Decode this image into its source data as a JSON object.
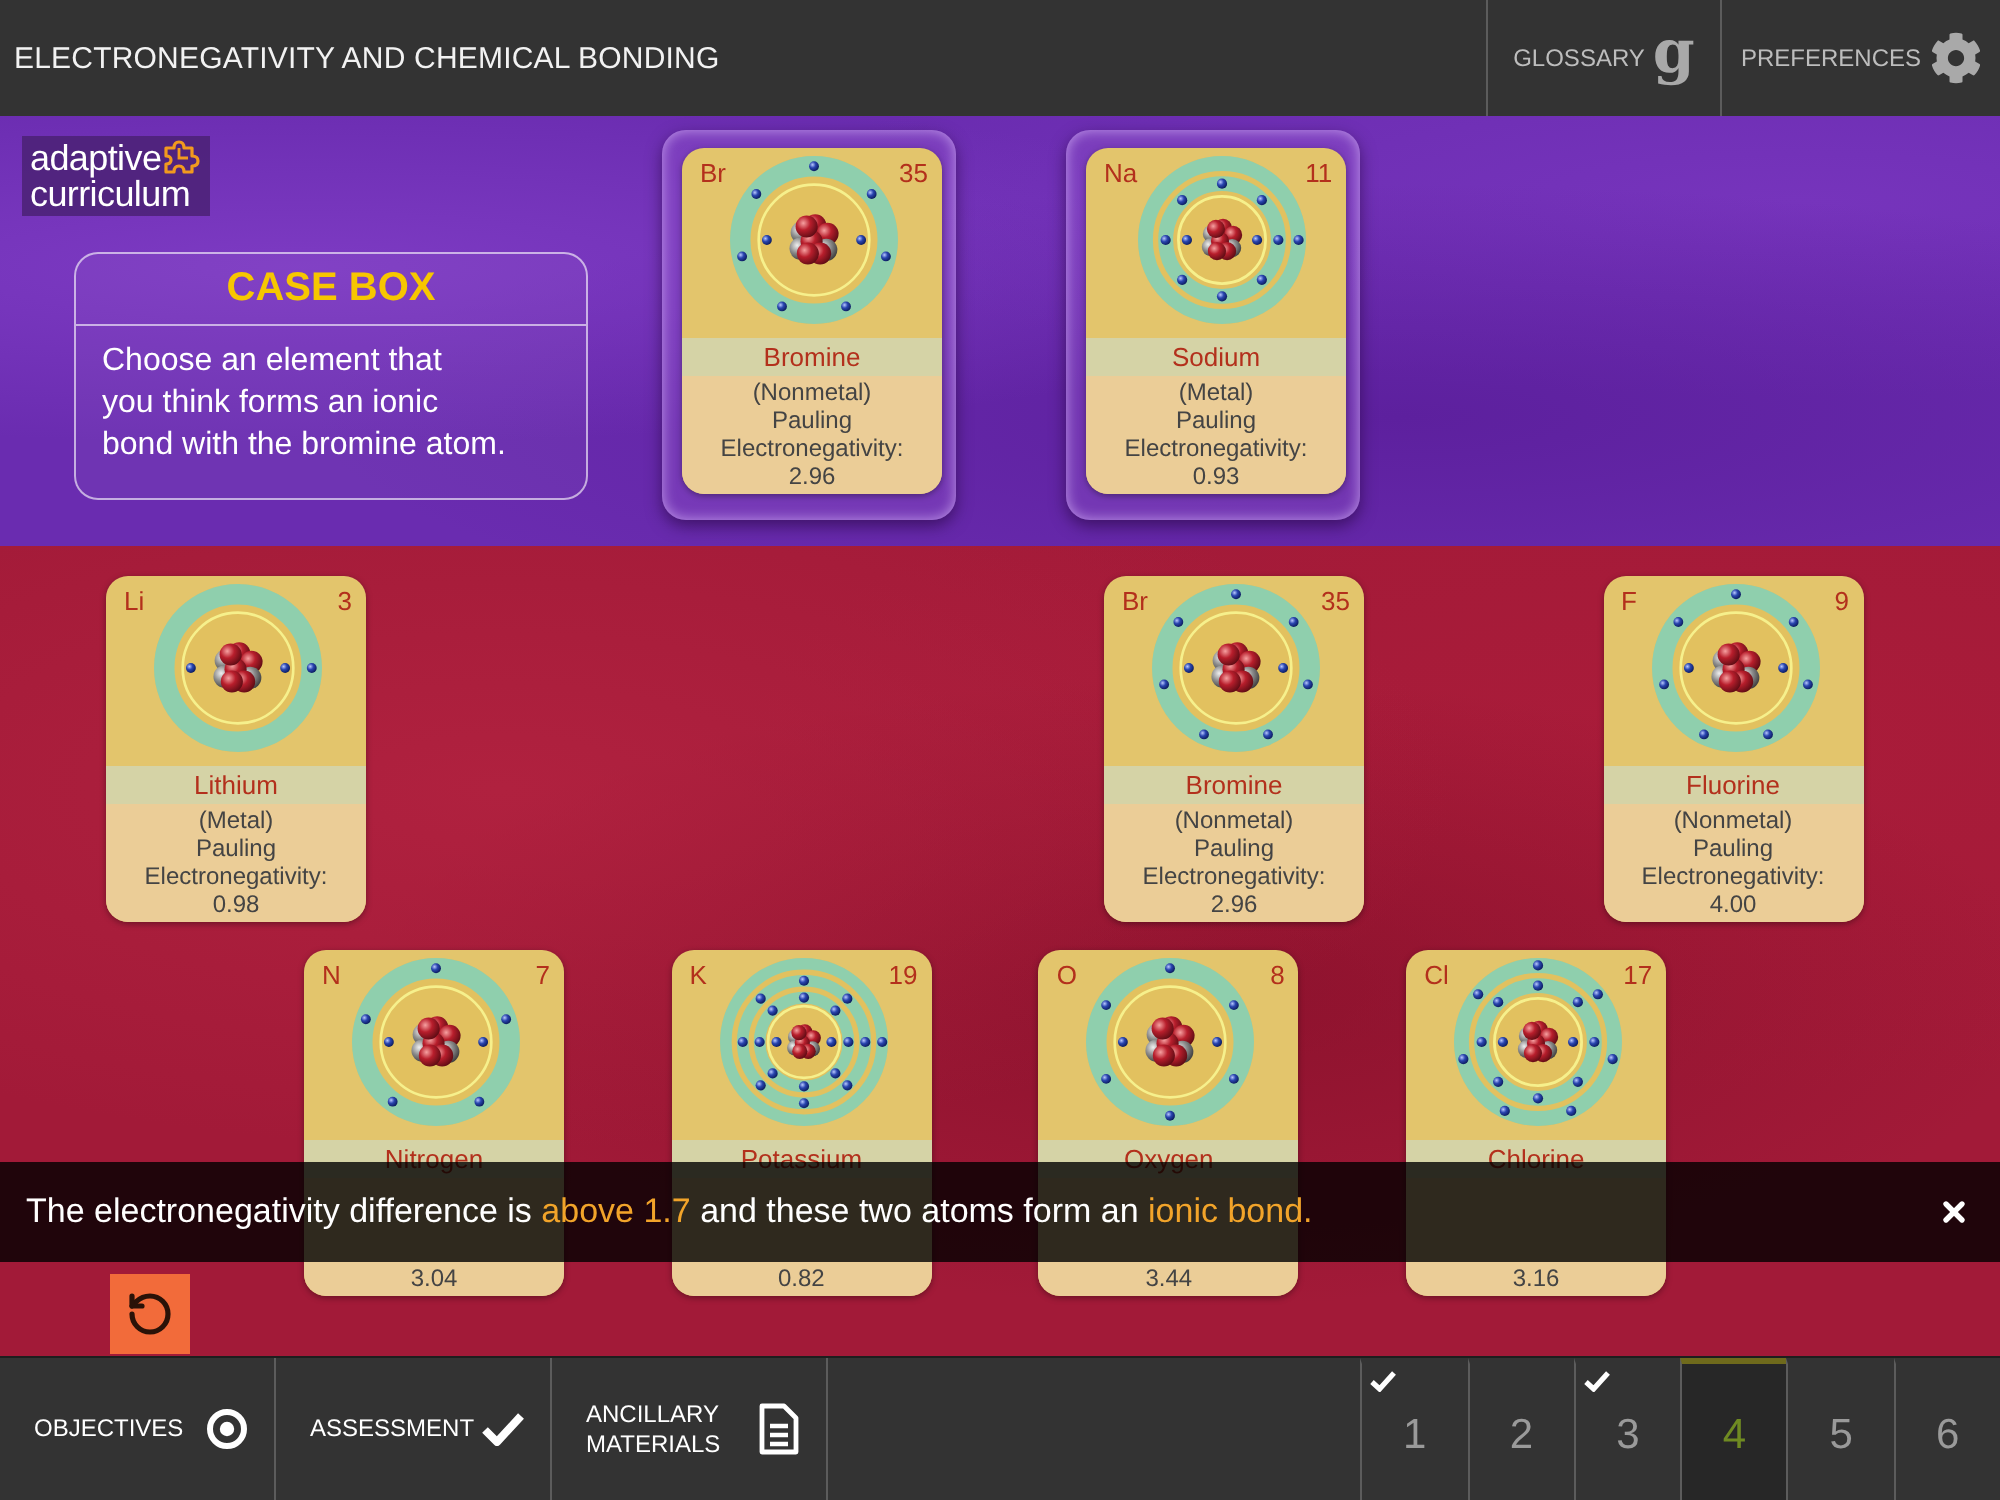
{
  "header": {
    "title": "ELECTRONEGATIVITY AND CHEMICAL BONDING",
    "glossary": {
      "label": "GLOSSARY",
      "glyph": "g"
    },
    "preferences": {
      "label": "PREFERENCES"
    }
  },
  "logo": {
    "lines": [
      "adaptive",
      "curriculum"
    ]
  },
  "case_box": {
    "title": "CASE BOX",
    "lines": [
      "Choose an element that",
      "you think forms an ionic",
      "bond with the bromine atom."
    ]
  },
  "bond_slots": [
    {
      "symbol": "Br",
      "number": "35",
      "name": "Bromine",
      "category": "(Nonmetal)",
      "property": "Pauling Electronegativity:",
      "value": "2.96"
    },
    {
      "symbol": "Na",
      "number": "11",
      "name": "Sodium",
      "category": "(Metal)",
      "property": "Pauling Electronegativity:",
      "value": "0.93"
    }
  ],
  "element_rows": [
    {
      "cards": [
        {
          "kind": "element",
          "symbol": "Li",
          "number": "3",
          "name": "Lithium",
          "category": "(Metal)",
          "property": "Pauling Electronegativity:",
          "value": "0.98"
        },
        {
          "kind": "empty"
        },
        {
          "kind": "element",
          "symbol": "Br",
          "number": "35",
          "name": "Bromine",
          "category": "(Nonmetal)",
          "property": "Pauling Electronegativity:",
          "value": "2.96"
        },
        {
          "kind": "element",
          "symbol": "F",
          "number": "9",
          "name": "Fluorine",
          "category": "(Nonmetal)",
          "property": "Pauling Electronegativity:",
          "value": "4.00"
        }
      ]
    },
    {
      "cards": [
        {
          "kind": "element",
          "symbol": "N",
          "number": "7",
          "name": "Nitrogen",
          "value": "3.04"
        },
        {
          "kind": "element",
          "symbol": "K",
          "number": "19",
          "name": "Potassium",
          "value": "0.82"
        },
        {
          "kind": "element",
          "symbol": "O",
          "number": "8",
          "name": "Oxygen",
          "value": "3.44"
        },
        {
          "kind": "element",
          "symbol": "Cl",
          "number": "17",
          "name": "Chlorine",
          "value": "3.16"
        }
      ]
    }
  ],
  "feedback": {
    "segments": [
      {
        "text": "The electronegativity difference is ",
        "highlight": false
      },
      {
        "text": "above 1.7",
        "highlight": true
      },
      {
        "text": " and these two atoms form an ",
        "highlight": false
      },
      {
        "text": "ionic bond.",
        "highlight": true
      }
    ]
  },
  "bottom_bar": {
    "sections": [
      {
        "kind": "objectives",
        "label": "OBJECTIVES"
      },
      {
        "kind": "assessment",
        "label": "ASSESSMENT"
      },
      {
        "kind": "materials",
        "label": "ANCILLARY MATERIALS"
      }
    ],
    "pages": [
      {
        "label": "1",
        "selected": false,
        "completed": true
      },
      {
        "label": "2",
        "selected": false,
        "completed": false
      },
      {
        "label": "3",
        "selected": false,
        "completed": true
      },
      {
        "label": "4",
        "selected": true,
        "completed": false
      },
      {
        "label": "5",
        "selected": false,
        "completed": false
      },
      {
        "label": "6",
        "selected": false,
        "completed": false
      }
    ]
  }
}
